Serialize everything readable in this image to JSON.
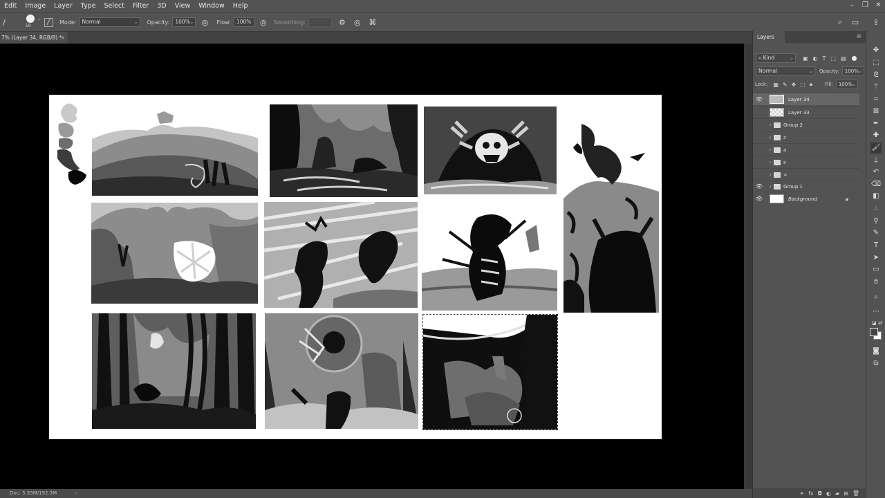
{
  "menu": [
    "Edit",
    "Image",
    "Layer",
    "Type",
    "Select",
    "Filter",
    "3D",
    "View",
    "Window",
    "Help"
  ],
  "window_controls": [
    "minimize-icon",
    "restore-icon",
    "close-icon"
  ],
  "options": {
    "brush_size": "50",
    "mode_label": "Mode:",
    "mode_value": "Normal",
    "opacity_label": "Opacity:",
    "opacity_value": "100%",
    "flow_label": "Flow:",
    "flow_value": "100%",
    "smoothing_label": "Smoothing:",
    "smoothing_value": ""
  },
  "document_tab": {
    "title": "7% (Layer 34, RGB/8) *",
    "close": "×"
  },
  "status": {
    "doc": "Doc: 5.93M/192.3M",
    "arrow": "›"
  },
  "layers_panel": {
    "tab": "Layers",
    "filter_kind": "Kind",
    "blend_mode": "Normal",
    "opacity_label": "Opacity:",
    "opacity_value": "100%",
    "lock_label": "Lock:",
    "fill_label": "Fill:",
    "fill_value": "100%",
    "layers": [
      {
        "name": "Layer 34",
        "visible": true,
        "type": "layer",
        "selected": true
      },
      {
        "name": "Layer 33",
        "visible": false,
        "type": "layer",
        "selected": false
      },
      {
        "name": "Group 2",
        "visible": false,
        "type": "group",
        "selected": false
      },
      {
        "name": "z",
        "visible": false,
        "type": "group",
        "selected": false
      },
      {
        "name": "a",
        "visible": false,
        "type": "group",
        "selected": false
      },
      {
        "name": "s",
        "visible": false,
        "type": "group",
        "selected": false
      },
      {
        "name": "<",
        "visible": false,
        "type": "group",
        "selected": false
      },
      {
        "name": "Group 1",
        "visible": true,
        "type": "group",
        "selected": false
      },
      {
        "name": "Background",
        "visible": true,
        "type": "background",
        "selected": false,
        "locked": true
      }
    ]
  },
  "thumbnails": [
    "value-swatches",
    "sketch-hills-travelers",
    "sketch-canyon-river",
    "sketch-skull-monster",
    "sketch-serpent-warrior",
    "sketch-volcano-glow",
    "sketch-figures-storm",
    "sketch-wild-creature",
    "sketch-forest",
    "sketch-giant-eye",
    "sketch-cliff-selection"
  ],
  "tools": [
    "move-tool-icon",
    "marquee-tool-icon",
    "lasso-tool-icon",
    "magic-wand-icon",
    "crop-tool-icon",
    "frame-tool-icon",
    "eyedropper-icon",
    "healing-brush-icon",
    "brush-tool-icon",
    "clone-stamp-icon",
    "history-brush-icon",
    "eraser-icon",
    "gradient-tool-icon",
    "blur-tool-icon",
    "dodge-tool-icon",
    "pen-tool-icon",
    "type-tool-icon",
    "path-select-icon",
    "rectangle-tool-icon",
    "hand-tool-icon",
    "zoom-tool-icon",
    "more-tools-icon",
    "default-colors-icon",
    "swap-colors-icon",
    "foreground-color-icon",
    "quick-mask-icon",
    "screen-mode-icon"
  ]
}
